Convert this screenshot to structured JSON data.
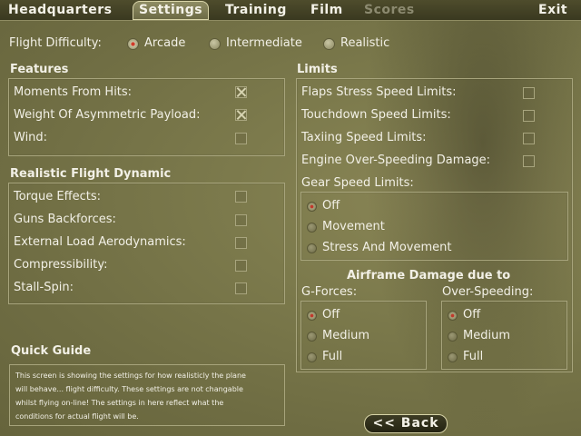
{
  "nav": {
    "tabs": [
      {
        "label": "Headquarters"
      },
      {
        "label": "Settings"
      },
      {
        "label": "Training"
      },
      {
        "label": "Film"
      },
      {
        "label": "Scores"
      }
    ],
    "exit": "Exit"
  },
  "difficulty": {
    "label": "Flight Difficulty:",
    "options": [
      "Arcade",
      "Intermediate",
      "Realistic"
    ],
    "selected": "Arcade"
  },
  "features": {
    "title": "Features",
    "items": [
      {
        "label": "Moments From Hits:",
        "checked": true
      },
      {
        "label": "Weight Of Asymmetric Payload:",
        "checked": true
      },
      {
        "label": "Wind:",
        "checked": false
      }
    ]
  },
  "realistic": {
    "title": "Realistic Flight Dynamic",
    "items": [
      {
        "label": "Torque Effects:",
        "checked": false
      },
      {
        "label": "Guns Backforces:",
        "checked": false
      },
      {
        "label": "External Load Aerodynamics:",
        "checked": false
      },
      {
        "label": "Compressibility:",
        "checked": false
      },
      {
        "label": "Stall-Spin:",
        "checked": false
      }
    ]
  },
  "limits": {
    "title": "Limits",
    "items": [
      {
        "label": "Flaps Stress Speed Limits:",
        "checked": false
      },
      {
        "label": "Touchdown Speed Limits:",
        "checked": false
      },
      {
        "label": "Taxiing Speed Limits:",
        "checked": false
      },
      {
        "label": "Engine Over-Speeding Damage:",
        "checked": false
      }
    ],
    "gear": {
      "title": "Gear Speed Limits:",
      "options": [
        "Off",
        "Movement",
        "Stress And Movement"
      ],
      "selected": "Off"
    },
    "airframe": {
      "title": "Airframe Damage due to",
      "gforces": {
        "title": "G-Forces:",
        "options": [
          "Off",
          "Medium",
          "Full"
        ],
        "selected": "Off"
      },
      "overspeeding": {
        "title": "Over-Speeding:",
        "options": [
          "Off",
          "Medium",
          "Full"
        ],
        "selected": "Off"
      }
    }
  },
  "guide": {
    "title": "Quick Guide",
    "lines": [
      "This screen is showing the settings for how realisticly the plane",
      "will behave... flight difficulty. These settings are not changable",
      "whilst flying on-line! The settings in here reflect what the",
      "conditions for actual flight will be."
    ]
  },
  "back_label": "<< Back",
  "colors": {
    "background": "#7c7a4c",
    "border": "#a7a47c",
    "text": "#f2f0e6",
    "selected_dot": "#d23a2a"
  }
}
